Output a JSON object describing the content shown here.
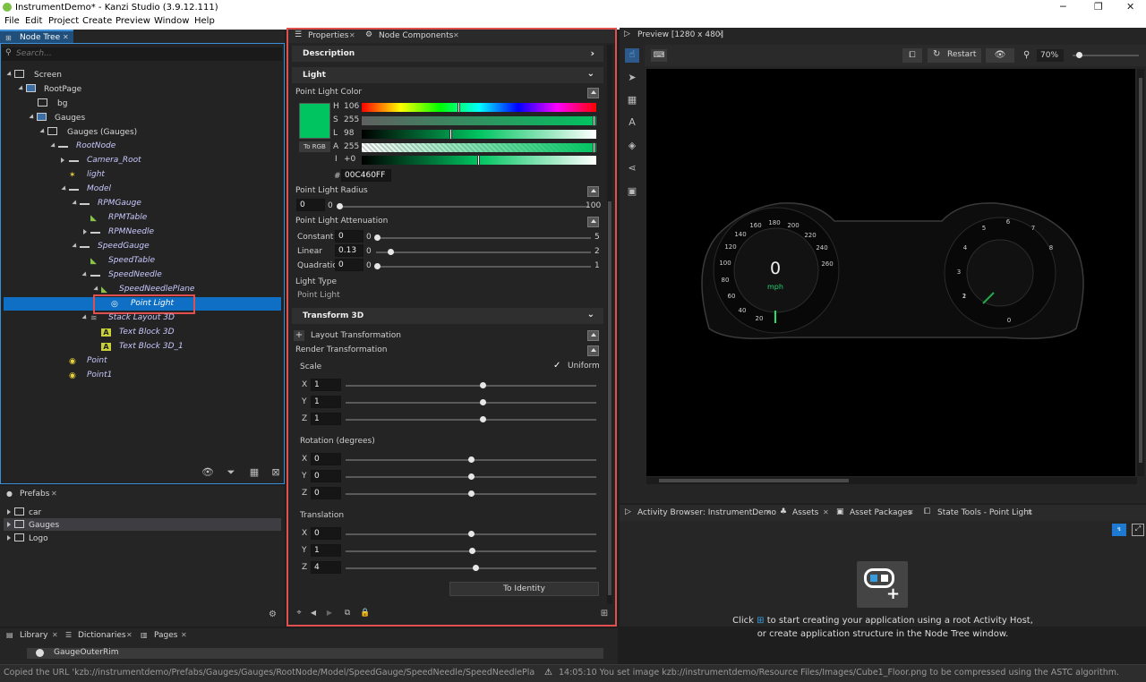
{
  "window": {
    "title": "InstrumentDemo* - Kanzi Studio (3.9.12.111)"
  },
  "menu": [
    "File",
    "Edit",
    "Project",
    "Create",
    "Preview",
    "Window",
    "Help"
  ],
  "nodetree": {
    "tab": "Node Tree",
    "search_placeholder": "Search...",
    "items": [
      "Screen",
      "RootPage",
      "bg",
      "Gauges",
      "Gauges (Gauges)",
      "RootNode",
      "Camera_Root",
      "light",
      "Model",
      "RPMGauge",
      "RPMTable",
      "RPMNeedle",
      "SpeedGauge",
      "SpeedTable",
      "SpeedNeedle",
      "SpeedNeedlePlane",
      "Point Light",
      "Stack Layout 3D",
      "Text Block 3D",
      "Text Block 3D_1",
      "Point",
      "Point1"
    ]
  },
  "prefabs": {
    "tab": "Prefabs",
    "items": [
      "car",
      "Gauges",
      "Logo"
    ]
  },
  "library": {
    "tabs": [
      "Library",
      "Dictionaries",
      "Pages"
    ],
    "item": "GaugeOuterRim"
  },
  "status": {
    "left": "Copied the URL 'kzb://instrumentdemo/Prefabs/Gauges/Gauges/RootNode/Model/SpeedGauge/SpeedNeedle/SpeedNeedlePlane' to you",
    "right": "14:05:10 You set image kzb://instrumentdemo/Resource Files/Images/Cube1_Floor.png to be compressed using the ASTC algorithm."
  },
  "properties": {
    "tabs": [
      "Properties",
      "Node Components"
    ],
    "description": "Description",
    "light_section": "Light",
    "color": {
      "label": "Point Light Color",
      "swatch": "#00C460",
      "to_rgb": "To RGB",
      "channels": [
        {
          "k": "H",
          "v": "106"
        },
        {
          "k": "S",
          "v": "255"
        },
        {
          "k": "L",
          "v": "98"
        },
        {
          "k": "A",
          "v": "255"
        },
        {
          "k": "I",
          "v": "+0"
        }
      ],
      "hash": "#",
      "hex": "00C460FF"
    },
    "radius": {
      "label": "Point Light Radius",
      "value": "0",
      "min": "0",
      "max": "100"
    },
    "attenuation": {
      "label": "Point Light Attenuation",
      "rows": [
        {
          "name": "Constant",
          "value": "0",
          "min": "0",
          "max": "5"
        },
        {
          "name": "Linear",
          "value": "0.13",
          "min": "0",
          "max": "2"
        },
        {
          "name": "Quadratic",
          "value": "0",
          "min": "0",
          "max": "1"
        }
      ]
    },
    "light_type": {
      "label": "Light Type",
      "value": "Point Light"
    },
    "transform_section": "Transform 3D",
    "layout_transformation": "Layout Transformation",
    "render_transformation": "Render Transformation",
    "scale": {
      "label": "Scale",
      "uniform": "Uniform",
      "x": "1",
      "y": "1",
      "z": "1"
    },
    "rotation": {
      "label": "Rotation (degrees)",
      "x": "0",
      "y": "0",
      "z": "0"
    },
    "translation": {
      "label": "Translation",
      "x": "0",
      "y": "1",
      "z": "4"
    },
    "to_identity": "To Identity"
  },
  "preview": {
    "tab": "Preview [1280 x 480]",
    "restart": "Restart",
    "zoom": "70%",
    "speed": "0",
    "unit": "mph",
    "speed_ticks": [
      "20",
      "40",
      "60",
      "80",
      "100",
      "120",
      "140",
      "160",
      "180",
      "200",
      "220",
      "240",
      "260"
    ],
    "rpm_ticks": [
      "0",
      "1",
      "2",
      "3",
      "4",
      "5",
      "6",
      "7",
      "8"
    ]
  },
  "activity": {
    "tabs": [
      "Activity Browser: InstrumentDemo",
      "Assets",
      "Asset Packages",
      "State Tools - Point Light"
    ],
    "line1a": "Click",
    "line1b": "to start creating your application using a root Activity Host,",
    "line2": "or create application structure in the Node Tree window."
  },
  "colors": {
    "accent": "#3a8fd8",
    "highlight": "#e05050",
    "selected": "#0e6fc4"
  }
}
